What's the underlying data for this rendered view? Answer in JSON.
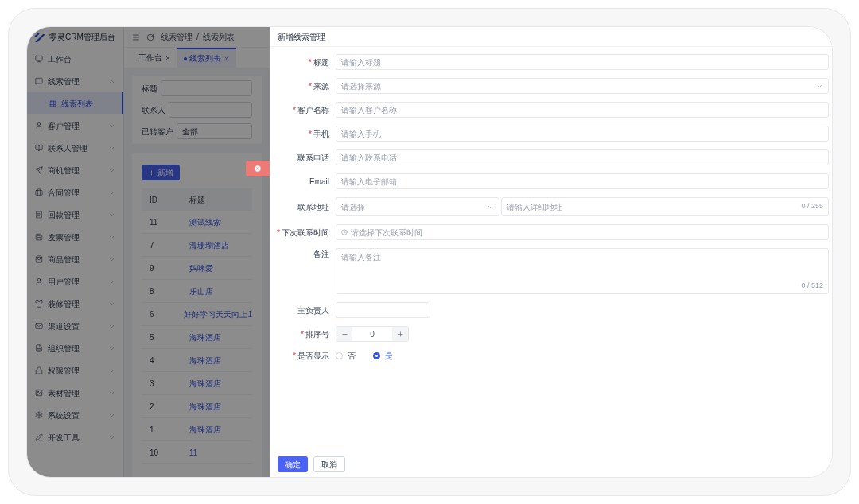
{
  "app": {
    "logo_title": "零灵CRM管理后台",
    "sidebar": {
      "items": [
        {
          "kind": "link",
          "label": "工作台"
        },
        {
          "kind": "group",
          "label": "线索管理",
          "expanded": true,
          "children": [
            {
              "label": "线索列表",
              "selected": true
            }
          ]
        },
        {
          "kind": "group",
          "label": "客户管理",
          "expanded": false
        },
        {
          "kind": "group",
          "label": "联系人管理",
          "expanded": false
        },
        {
          "kind": "group",
          "label": "商机管理",
          "expanded": false
        },
        {
          "kind": "group",
          "label": "合同管理",
          "expanded": false
        },
        {
          "kind": "group",
          "label": "回款管理",
          "expanded": false
        },
        {
          "kind": "group",
          "label": "发票管理",
          "expanded": false
        },
        {
          "kind": "group",
          "label": "商品管理",
          "expanded": false
        },
        {
          "kind": "group",
          "label": "用户管理",
          "expanded": false
        },
        {
          "kind": "group",
          "label": "装修管理",
          "expanded": false
        },
        {
          "kind": "group",
          "label": "渠道设置",
          "expanded": false
        },
        {
          "kind": "group",
          "label": "组织管理",
          "expanded": false
        },
        {
          "kind": "group",
          "label": "权限管理",
          "expanded": false
        },
        {
          "kind": "group",
          "label": "素材管理",
          "expanded": false
        },
        {
          "kind": "group",
          "label": "系统设置",
          "expanded": false
        },
        {
          "kind": "group",
          "label": "开发工具",
          "expanded": false
        }
      ]
    },
    "breadcrumb": [
      "线索管理",
      "/",
      "线索列表"
    ],
    "tabs": [
      {
        "label": "工作台",
        "selected": false
      },
      {
        "label": "线索列表",
        "selected": true
      }
    ],
    "filters": [
      {
        "label": "标题"
      },
      {
        "label": "联系人"
      },
      {
        "label": "已转客户",
        "value": "全部"
      }
    ],
    "new_button": "新增",
    "table": {
      "columns": [
        "ID",
        "标题"
      ],
      "rows": [
        [
          "11",
          "测试线索"
        ],
        [
          "7",
          "海珊瑚酒店"
        ],
        [
          "9",
          "妈咪爱"
        ],
        [
          "8",
          "乐山店"
        ],
        [
          "6",
          "好好学习天天向上1"
        ],
        [
          "5",
          "海珠酒店"
        ],
        [
          "4",
          "海珠酒店"
        ],
        [
          "3",
          "海珠酒店"
        ],
        [
          "2",
          "海珠酒店"
        ],
        [
          "1",
          "海珠酒店"
        ],
        [
          "10",
          "11"
        ]
      ]
    }
  },
  "drawer": {
    "title": "新增线索管理",
    "fields": [
      {
        "kind": "text",
        "mark": "*",
        "label": "标题",
        "placeholder": "请输入标题"
      },
      {
        "kind": "select",
        "mark": "*",
        "label": "来源",
        "placeholder": "请选择来源"
      },
      {
        "kind": "text",
        "mark": "*",
        "label": "客户名称",
        "placeholder": "请输入客户名称"
      },
      {
        "kind": "text",
        "mark": "*",
        "label": "手机",
        "placeholder": "请输入手机"
      },
      {
        "kind": "text",
        "label": "联系电话",
        "placeholder": "请输入联系电话"
      },
      {
        "kind": "text",
        "label": "Email",
        "placeholder": "请输入电子邮箱"
      },
      {
        "kind": "address",
        "label": "联系地址",
        "placeholder": "请选择",
        "detail_placeholder": "请输入详细地址",
        "counter": "0 / 255"
      },
      {
        "kind": "datetime",
        "mark": "*",
        "label": "下次联系时间",
        "placeholder": "请选择下次联系时间"
      },
      {
        "kind": "textarea",
        "label": "备注",
        "placeholder": "请输入备注",
        "counter": "0 / 512"
      },
      {
        "kind": "short",
        "label": "主负责人"
      },
      {
        "kind": "number",
        "mark": "*",
        "label": "排序号",
        "value": "0"
      },
      {
        "kind": "radio",
        "mark": "*",
        "label": "是否显示",
        "options": [
          {
            "label": "否",
            "selected": false
          },
          {
            "label": "是",
            "selected": true
          }
        ]
      }
    ],
    "buttons": [
      {
        "kind": "primary",
        "label": "确定"
      },
      {
        "kind": "default",
        "label": "取消"
      }
    ]
  }
}
